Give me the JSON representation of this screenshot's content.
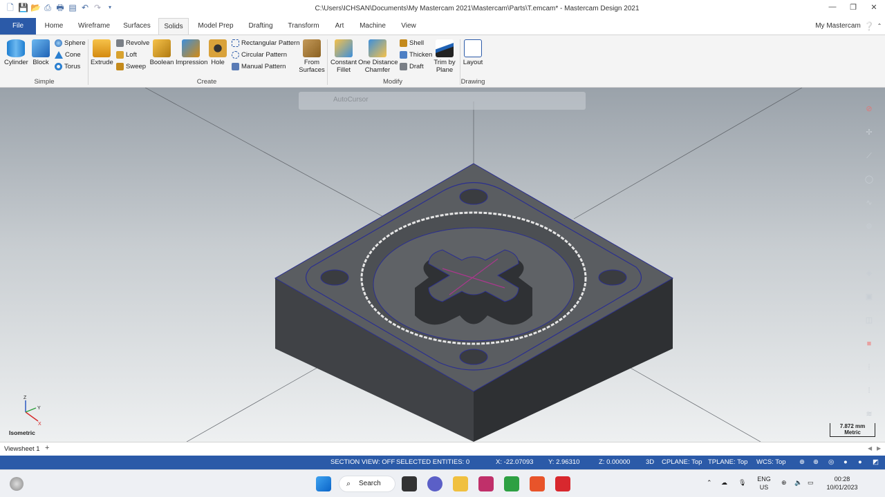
{
  "window": {
    "title": "C:\\Users\\ICHSAN\\Documents\\My Mastercam 2021\\Mastercam\\Parts\\T.emcam* - Mastercam Design 2021",
    "account_label": "My Mastercam"
  },
  "tabs": [
    "File",
    "Home",
    "Wireframe",
    "Surfaces",
    "Solids",
    "Model Prep",
    "Drafting",
    "Transform",
    "Art",
    "Machine",
    "View"
  ],
  "ribbon": {
    "simple": {
      "label": "Simple",
      "cylinder": "Cylinder",
      "block": "Block",
      "sphere": "Sphere",
      "cone": "Cone",
      "torus": "Torus"
    },
    "create": {
      "label": "Create",
      "extrude": "Extrude",
      "revolve": "Revolve",
      "loft": "Loft",
      "sweep": "Sweep",
      "boolean": "Boolean",
      "impression": "Impression",
      "hole": "Hole",
      "rect_pattern": "Rectangular Pattern",
      "circ_pattern": "Circular Pattern",
      "manual_pattern": "Manual Pattern",
      "from_surfaces_1": "From",
      "from_surfaces_2": "Surfaces"
    },
    "modify": {
      "label": "Modify",
      "constant_fillet_1": "Constant",
      "constant_fillet_2": "Fillet",
      "one_distance_1": "One Distance",
      "one_distance_2": "Chamfer",
      "shell": "Shell",
      "thicken": "Thicken",
      "draft": "Draft",
      "trim_1": "Trim by",
      "trim_2": "Plane"
    },
    "drawing": {
      "label": "Drawing",
      "layout": "Layout"
    }
  },
  "viewport": {
    "autocursor": "AutoCursor",
    "view_name": "Isometric",
    "scale_value": "7.872 mm",
    "scale_unit": "Metric",
    "axis_x": "X",
    "axis_y": "Y",
    "axis_z": "Z"
  },
  "sheet": {
    "name": "Viewsheet 1",
    "add": "+"
  },
  "status": {
    "section_view": "SECTION VIEW: OFF",
    "selected": "SELECTED ENTITIES: 0",
    "x": "X:  -22.07093",
    "y": "Y:  2.96310",
    "z": "Z:  0.00000",
    "mode": "3D",
    "cplane": "CPLANE: Top",
    "tplane": "TPLANE: Top",
    "wcs": "WCS: Top"
  },
  "taskbar": {
    "search": "Search",
    "lang_1": "ENG",
    "lang_2": "US",
    "time": "00:28",
    "date": "10/01/2023"
  },
  "colors": {
    "accent": "#2b5aa8",
    "model_dark": "#3f4145",
    "model_top": "#5b5e62",
    "edges": "#2b2f8f"
  }
}
